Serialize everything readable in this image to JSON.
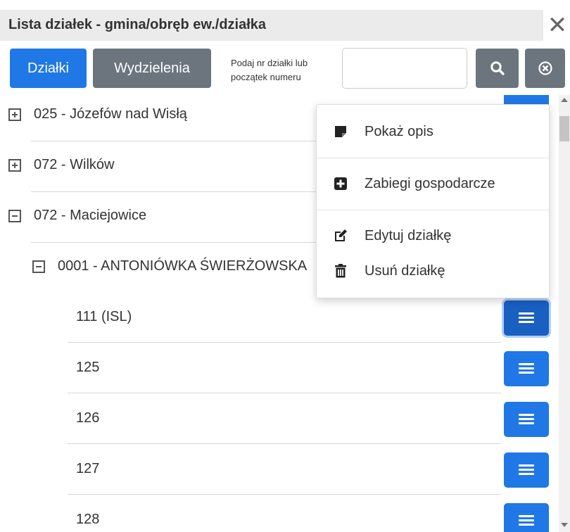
{
  "header": {
    "title": "Lista działek - gmina/obręb ew./działka",
    "close_glyph": "✕"
  },
  "toolbar": {
    "tab_dzialki": "Działki",
    "tab_wydzielenia": "Wydzielenia",
    "search_hint_line1": "Podaj nr działki lub",
    "search_hint_line2": "początek numeru",
    "search_value": "",
    "search_icon": "search-icon",
    "clear_icon": "clear-circle-icon"
  },
  "tree": {
    "gminas": [
      {
        "label": "025 - Józefów nad Wisłą",
        "expanded": false
      },
      {
        "label": "072 - Wilków",
        "expanded": false
      },
      {
        "label": "072 - Maciejowice",
        "expanded": true
      }
    ],
    "obreb": {
      "label": "0001 - ANTONIÓWKA ŚWIERŻOWSKA",
      "expanded": true
    },
    "parcels": [
      {
        "label": "111 (ISL)",
        "active": true
      },
      {
        "label": "125",
        "active": false
      },
      {
        "label": "126",
        "active": false
      },
      {
        "label": "127",
        "active": false
      },
      {
        "label": "128",
        "active": false
      }
    ]
  },
  "context_menu": {
    "items": [
      {
        "label": "Pokaż opis",
        "icon": "sticky-note-icon"
      },
      {
        "label": "Zabiegi gospodarcze",
        "icon": "plus-square-icon"
      },
      {
        "label": "Edytuj działkę",
        "icon": "edit-icon"
      },
      {
        "label": "Usuń działkę",
        "icon": "trash-icon"
      }
    ]
  },
  "colors": {
    "primary": "#1f78e6",
    "secondary": "#6c757d",
    "header_bg": "#ebebeb"
  }
}
